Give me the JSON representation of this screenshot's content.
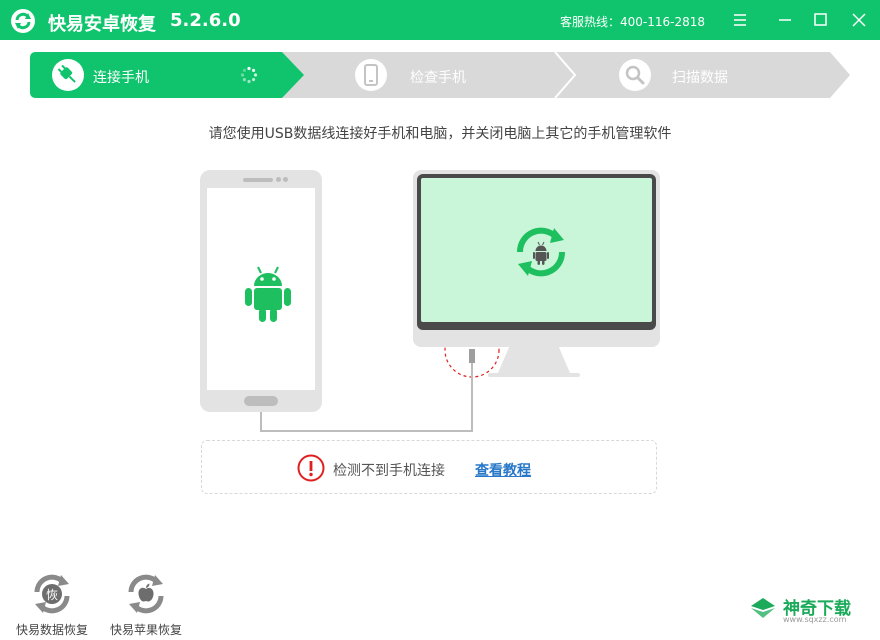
{
  "app": {
    "title": "快易安卓恢复",
    "version": "5.2.6.0",
    "hotline": "客服热线：400-116-2818"
  },
  "colors": {
    "brand_green": "#0fc46c",
    "step_inactive": "#d9d9d9",
    "link_blue": "#2877c9",
    "warn_red": "#e02020",
    "android_green": "#1dbf5e"
  },
  "steps": [
    {
      "label": "连接手机",
      "icon": "plug-icon",
      "state": "active"
    },
    {
      "label": "检查手机",
      "icon": "phone-icon",
      "state": "inactive"
    },
    {
      "label": "扫描数据",
      "icon": "magnifier-icon",
      "state": "inactive"
    }
  ],
  "instruction": "请您使用USB数据线连接好手机和电脑，并关闭电脑上其它的手机管理软件",
  "status": {
    "message": "检测不到手机连接",
    "link": "查看教程",
    "icon": "warning-icon"
  },
  "tools": [
    {
      "label": "快易数据恢复",
      "icon": "data-recovery-icon",
      "glyph": "恢"
    },
    {
      "label": "快易苹果恢复",
      "icon": "apple-recovery-icon"
    }
  ],
  "watermark": {
    "text": "神奇下载",
    "sub": "www.sqxzz.com"
  }
}
